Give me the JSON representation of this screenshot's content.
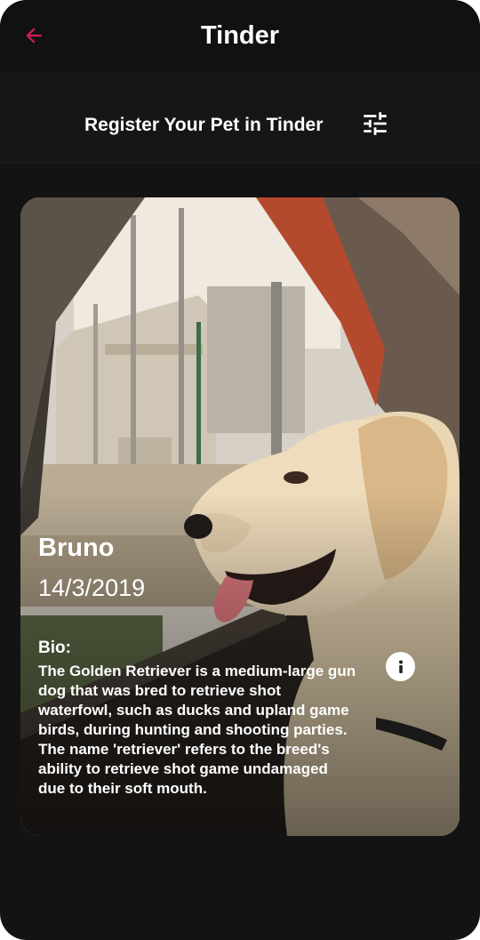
{
  "app": {
    "title": "Tinder",
    "accent_color": "#d81b60",
    "back_icon": "arrow-left-icon"
  },
  "subheader": {
    "title": "Register Your Pet in Tinder",
    "filter_icon": "tune-sliders-icon"
  },
  "pet": {
    "name": "Bruno",
    "date": "14/3/2019",
    "bio_label": "Bio:",
    "bio": "The Golden Retriever is a medium-large gun dog that was bred to retrieve shot waterfowl, such as ducks and upland game birds, during hunting and shooting parties. The name 'retriever' refers to the breed's ability to retrieve shot game undamaged due to their soft mouth.",
    "info_icon": "info-icon",
    "photo_subject": "golden retriever in car window"
  }
}
